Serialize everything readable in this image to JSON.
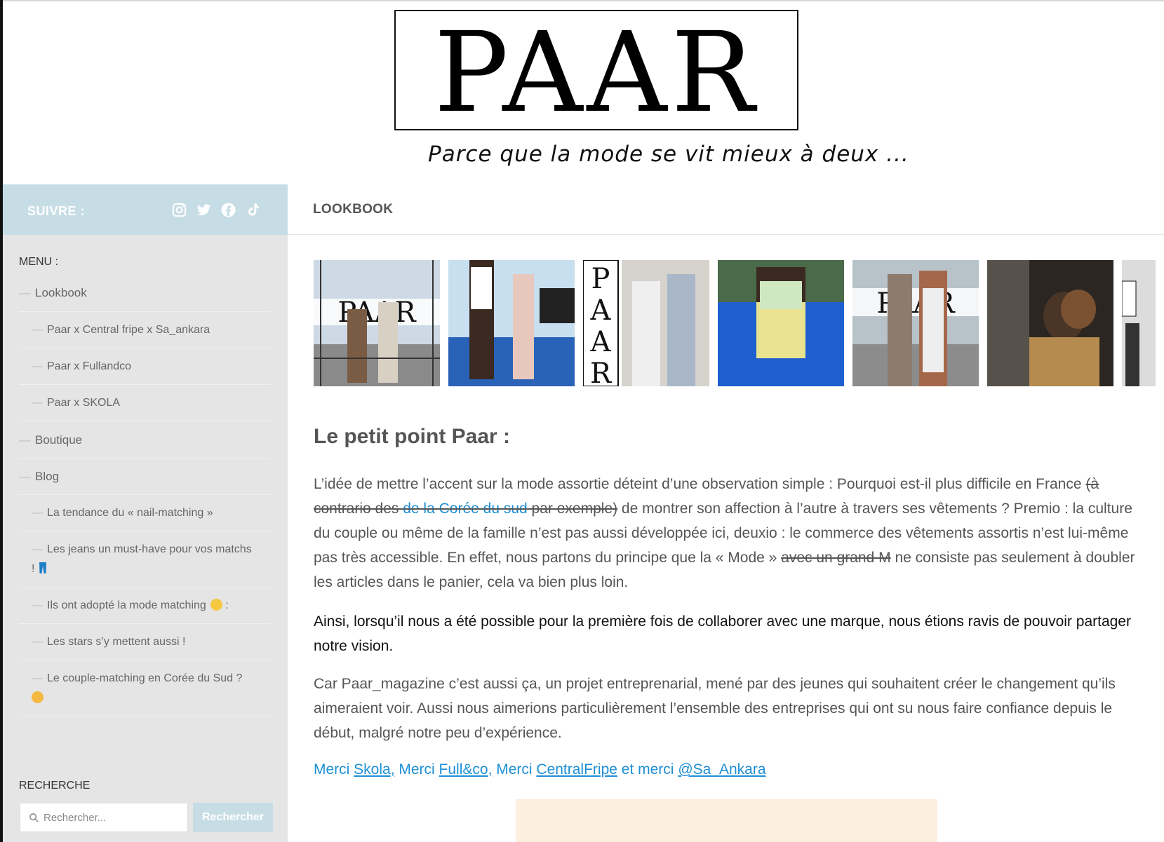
{
  "header": {
    "logo_text": "PAAR",
    "tagline": "Parce que la mode se vit mieux à deux ..."
  },
  "sidebar": {
    "follow_label": "SUIVRE :",
    "social_icons": [
      "instagram-icon",
      "twitter-icon",
      "facebook-icon",
      "tiktok-icon"
    ],
    "menu_title": "MENU :",
    "menu": [
      {
        "label": "Lookbook",
        "level": 1
      },
      {
        "label": "Paar x Central fripe x Sa_ankara",
        "level": 2
      },
      {
        "label": "Paar x Fullandco",
        "level": 2
      },
      {
        "label": "Paar x SKOLA",
        "level": 2
      },
      {
        "label": "Boutique",
        "level": 1
      },
      {
        "label": "Blog",
        "level": 1
      },
      {
        "label": "La tendance du « nail-matching »",
        "level": 2
      },
      {
        "label": "Les jeans un must-have pour vos matchs !",
        "level": 2,
        "emoji": "jeans"
      },
      {
        "label": "Ils ont adopté la mode matching",
        "level": 2,
        "emoji": "handshake",
        "suffix": " :"
      },
      {
        "label": "Les stars s’y mettent aussi !",
        "level": 2
      },
      {
        "label": "Le couple-matching en Corée du Sud ?",
        "level": 2,
        "emoji": "thinking"
      }
    ],
    "search_title": "RECHERCHE",
    "search_placeholder": "Rechercher...",
    "search_button": "Rechercher"
  },
  "main": {
    "page_title": "LOOKBOOK",
    "gallery_count": 7,
    "heading": "Le petit point Paar :",
    "p1": {
      "a": "L’idée de mettre l’accent sur la mode assortie déteint d’une observation simple : Pourquoi est-il plus difficile en France ",
      "s1": "(à contrario des ",
      "s1_link": "de la Corée du sud",
      "s1_end": " par exemple)",
      "b": " de montrer son affection à l’autre à travers ses vêtements ? Premio : la culture du couple ou même de la famille n’est pas aussi développée ici, deuxio : le commerce des vêtements assortis n’est lui-même pas très accessible. En effet, nous partons du principe que la « Mode » ",
      "s2": "avec un grand M",
      "c": " ne consiste pas seulement à doubler les articles dans le panier, cela va bien plus loin."
    },
    "p2": "Ainsi, lorsqu’il nous a été possible pour la première fois de collaborer avec une marque, nous étions ravis de pouvoir partager notre vision.",
    "p3": "Car Paar_magazine c’est aussi ça, un projet entreprenarial, mené par des jeunes qui souhaitent créer le changement qu’ils aimeraient voir. Aussi nous aimerions particulièrement l’ensemble des entreprises qui ont su nous faire confiance depuis le début, malgré notre peu d’expérience.",
    "merci": {
      "t1": "Merci ",
      "l1": "Skola,",
      "t2": " Merci ",
      "l2": "Full&co,",
      "t3": " Merci ",
      "l3": "CentralFripe",
      "t4": " et merci ",
      "l4": "@Sa_Ankara"
    }
  },
  "colors": {
    "sidebar_bg": "#e5e5e5",
    "accent": "#c7dde5",
    "link": "#1e8fd5",
    "embed_bg": "#fcefdf"
  }
}
